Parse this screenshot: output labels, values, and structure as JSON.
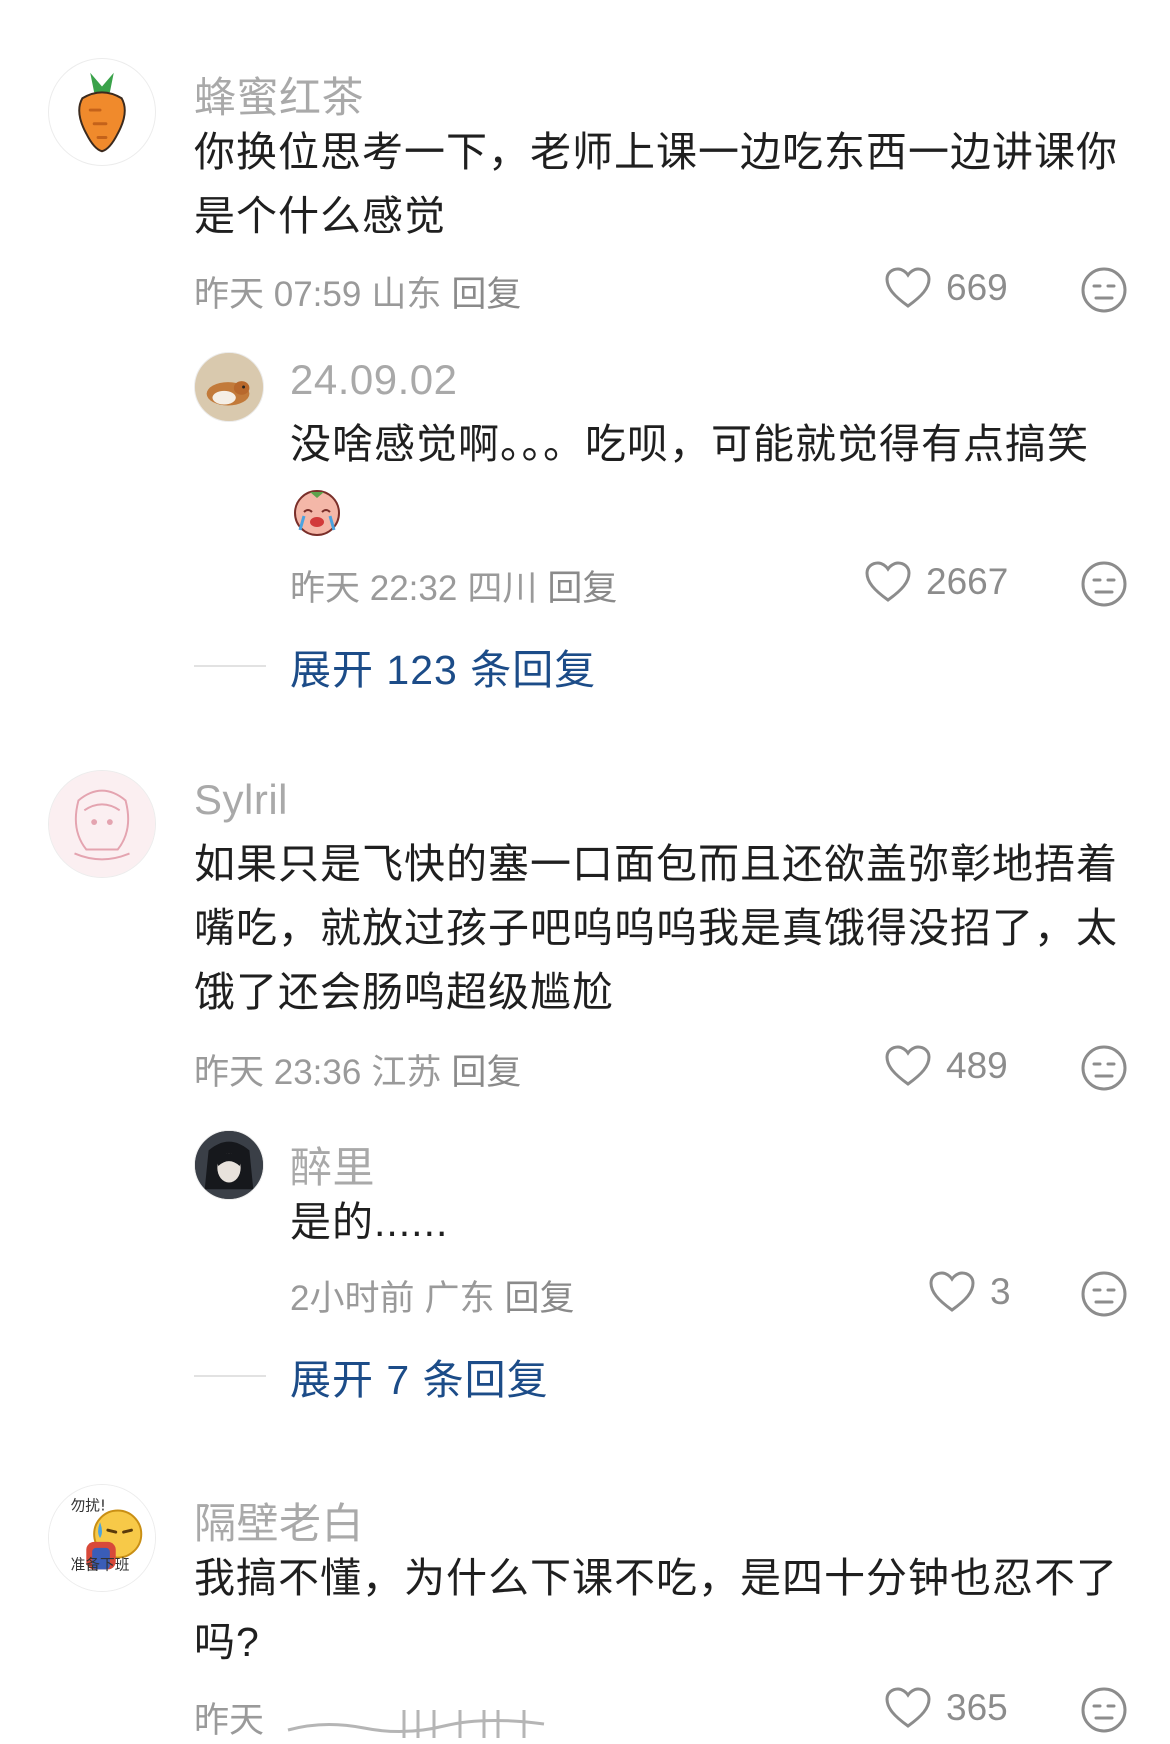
{
  "comments": [
    {
      "username": "蜂蜜红茶",
      "text": "你换位思考一下，老师上课一边吃东西一边讲课你是个什么感觉",
      "time": "昨天 07:59",
      "location": "山东",
      "reply_label": "回复",
      "likes": "669",
      "avatar_icon": "carrot-icon",
      "replies": [
        {
          "username": "24.09.02",
          "text": "没啥感觉啊。。。吃呗，可能就觉得有点搞笑",
          "emoji": "crying-face-sticker",
          "time": "昨天 22:32",
          "location": "四川",
          "reply_label": "回复",
          "likes": "2667",
          "avatar_icon": "corgi-photo"
        }
      ],
      "expand_label": "展开 123 条回复"
    },
    {
      "username": "Sylril",
      "text": "如果只是飞快的塞一口面包而且还欲盖弥彰地捂着嘴吃，就放过孩子吧呜呜呜我是真饿得没招了，太饿了还会肠鸣超级尴尬",
      "time": "昨天 23:36",
      "location": "江苏",
      "reply_label": "回复",
      "likes": "489",
      "avatar_icon": "anime-girl-sketch",
      "replies": [
        {
          "username": "醉里",
          "text": "是的......",
          "time": "2小时前",
          "location": "广东",
          "reply_label": "回复",
          "likes": "3",
          "avatar_icon": "dark-hair-portrait"
        }
      ],
      "expand_label": "展开 7 条回复"
    },
    {
      "username": "隔壁老白",
      "text": "我搞不懂，为什么下课不吃，是四十分钟也忍不了吗?",
      "time": "昨天",
      "likes": "365",
      "avatar_icon": "sweating-emoji-sticker",
      "avatar_text_top": "勿扰!",
      "avatar_text_bottom": "准备下班"
    }
  ],
  "colors": {
    "username": "#a9a9a9",
    "text": "#1f1f1f",
    "meta": "#9a9a9a",
    "expand_link": "#1c4c88"
  }
}
